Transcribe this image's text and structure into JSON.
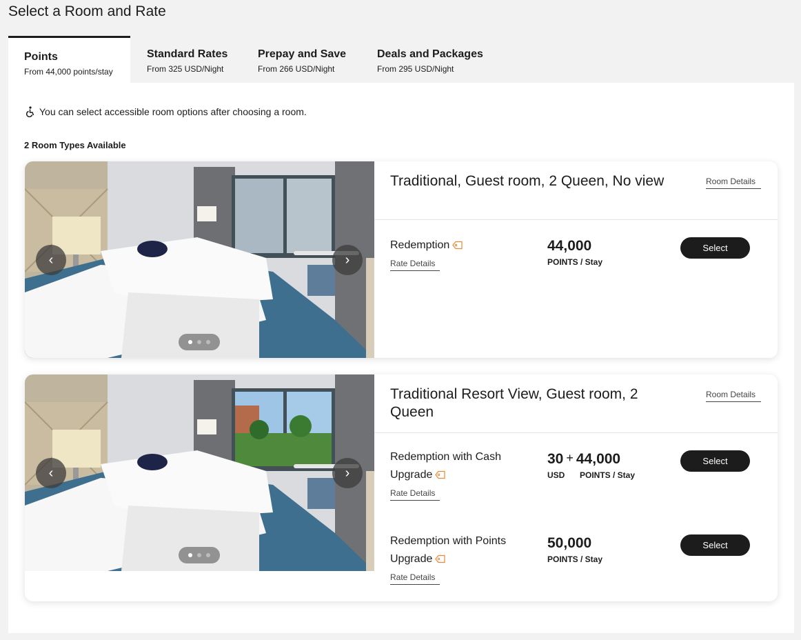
{
  "page_title": "Select a Room and Rate",
  "tabs": [
    {
      "label": "Points",
      "sub": "From 44,000 points/stay"
    },
    {
      "label": "Standard Rates",
      "sub": "From 325 USD/Night"
    },
    {
      "label": "Prepay and Save",
      "sub": "From 266 USD/Night"
    },
    {
      "label": "Deals and Packages",
      "sub": "From 295 USD/Night"
    }
  ],
  "accessibility_note": "You can select accessible room options after choosing a room.",
  "available_text": "2 Room Types Available",
  "rooms": [
    {
      "title": "Traditional, Guest room, 2 Queen, No view",
      "details_link": "Room Details",
      "rates": [
        {
          "name": "Redemption",
          "details_link": "Rate Details",
          "amount": "44,000",
          "unit": "POINTS / Stay",
          "button": "Select"
        }
      ]
    },
    {
      "title": "Traditional Resort View, Guest room, 2 Queen",
      "details_link": "Room Details",
      "rates": [
        {
          "name": "Redemption with Cash Upgrade",
          "details_link": "Rate Details",
          "cash": "30",
          "plus": "+",
          "amount": "44,000",
          "cash_unit": "USD",
          "unit": "POINTS / Stay",
          "button": "Select"
        },
        {
          "name": "Redemption with Points Upgrade",
          "details_link": "Rate Details",
          "amount": "50,000",
          "unit": "POINTS / Stay",
          "button": "Select"
        }
      ]
    }
  ],
  "colors": {
    "accent_tag": "#e58a3a",
    "button_bg": "#1c1c1c",
    "page_bg": "#f2f2f2"
  }
}
